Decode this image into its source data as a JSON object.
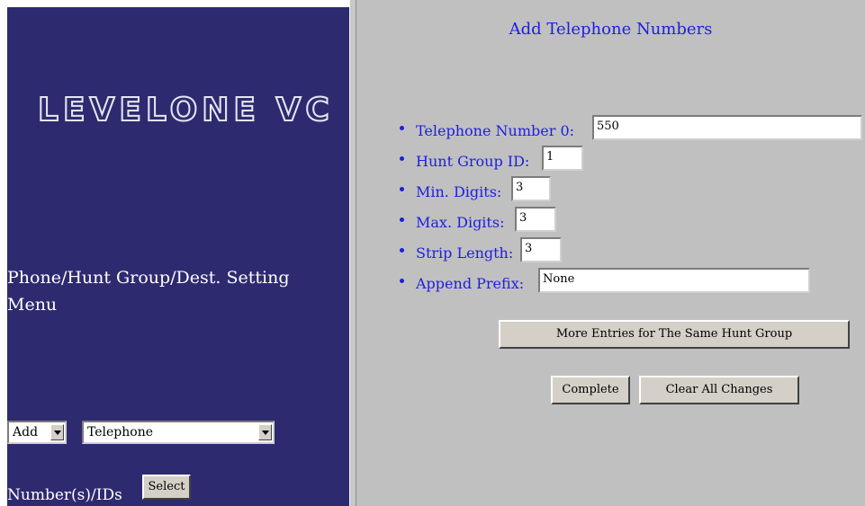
{
  "left": {
    "logo_text": "LEVELONE VC",
    "menu_title": "Phone/Hunt Group/Dest. Setting Menu",
    "action_select": "Add",
    "type_select": "Telephone",
    "numbers_label": "Number(s)/IDs",
    "select_button": "Select"
  },
  "main": {
    "title": "Add Telephone Numbers",
    "fields": [
      {
        "label": "Telephone Number 0:",
        "value": "550"
      },
      {
        "label": "Hunt Group ID:",
        "value": "1"
      },
      {
        "label": "Min. Digits:",
        "value": "3"
      },
      {
        "label": "Max. Digits:",
        "value": "3"
      },
      {
        "label": "Strip Length:",
        "value": "3"
      },
      {
        "label": "Append Prefix:",
        "value": "None"
      }
    ],
    "more_entries_button": "More Entries for The Same Hunt Group",
    "complete_button": "Complete",
    "clear_button": "Clear All Changes"
  }
}
